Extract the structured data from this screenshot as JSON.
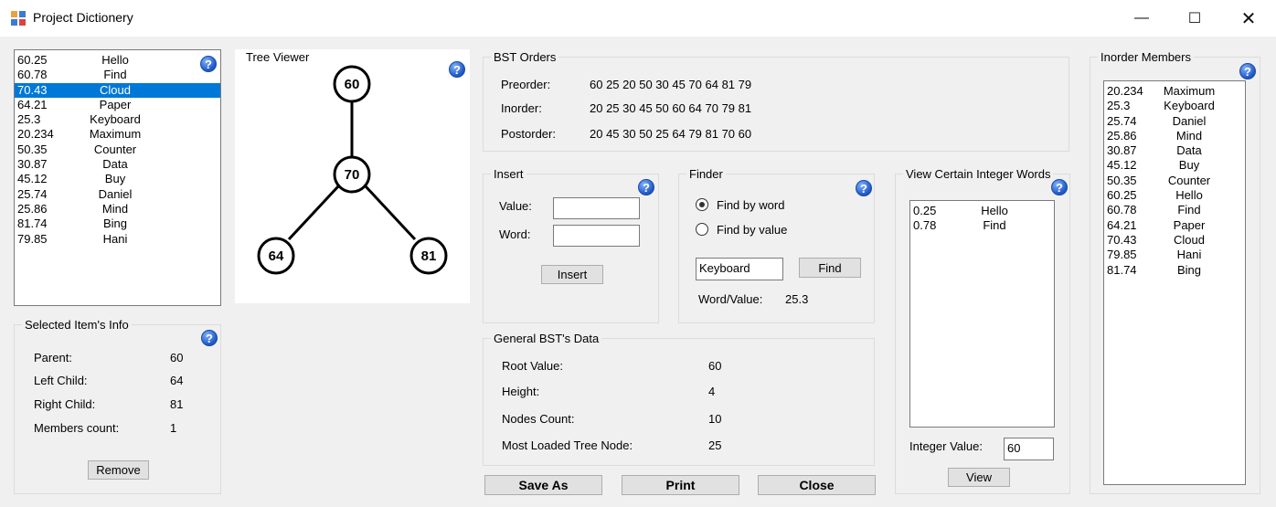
{
  "window": {
    "title": "Project Dictionery",
    "minimize_glyph": "—",
    "maximize_glyph": "☐",
    "close_glyph": "✕"
  },
  "help_glyph": "?",
  "main_list": {
    "items": [
      {
        "value": "60.25",
        "word": "Hello"
      },
      {
        "value": "60.78",
        "word": "Find"
      },
      {
        "value": "70.43",
        "word": "Cloud",
        "selected": true
      },
      {
        "value": "64.21",
        "word": "Paper"
      },
      {
        "value": "25.3",
        "word": "Keyboard"
      },
      {
        "value": "20.234",
        "word": "Maximum"
      },
      {
        "value": "50.35",
        "word": "Counter"
      },
      {
        "value": "30.87",
        "word": "Data"
      },
      {
        "value": "45.12",
        "word": "Buy"
      },
      {
        "value": "25.74",
        "word": "Daniel"
      },
      {
        "value": "25.86",
        "word": "Mind"
      },
      {
        "value": "81.74",
        "word": "Bing"
      },
      {
        "value": "79.85",
        "word": "Hani"
      }
    ]
  },
  "selected_info": {
    "title": "Selected Item's Info",
    "parent_label": "Parent:",
    "parent_value": "60",
    "left_label": "Left Child:",
    "left_value": "64",
    "right_label": "Right Child:",
    "right_value": "81",
    "count_label": "Members count:",
    "count_value": "1",
    "remove_button": "Remove"
  },
  "tree_viewer": {
    "title": "Tree Viewer",
    "nodes": {
      "root": "60",
      "mid": "70",
      "left": "64",
      "right": "81"
    }
  },
  "bst_orders": {
    "title": "BST Orders",
    "preorder_label": "Preorder:",
    "preorder_value": "60 25 20 50 30 45 70 64 81 79",
    "inorder_label": "Inorder:",
    "inorder_value": "20 25 30 45 50 60 64 70 79 81",
    "postorder_label": "Postorder:",
    "postorder_value": "20 45 30 50 25 64 79 81 70 60"
  },
  "insert": {
    "title": "Insert",
    "value_label": "Value:",
    "value_input": "",
    "word_label": "Word:",
    "word_input": "",
    "button": "Insert"
  },
  "finder": {
    "title": "Finder",
    "by_word_label": "Find by word",
    "by_value_label": "Find by value",
    "selected_mode": "word",
    "query": "Keyboard",
    "button": "Find",
    "result_label": "Word/Value:",
    "result_value": "25.3"
  },
  "general": {
    "title": "General BST's Data",
    "root_label": "Root Value:",
    "root_value": "60",
    "height_label": "Height:",
    "height_value": "4",
    "nodes_label": "Nodes Count:",
    "nodes_value": "10",
    "loaded_label": "Most Loaded Tree Node:",
    "loaded_value": "25"
  },
  "integer_words": {
    "title": "View Certain Integer Words",
    "items": [
      {
        "value": "0.25",
        "word": "Hello"
      },
      {
        "value": "0.78",
        "word": "Find"
      }
    ],
    "int_label": "Integer Value:",
    "int_value": "60",
    "button": "View"
  },
  "inorder_members": {
    "title": "Inorder Members",
    "items": [
      {
        "value": "20.234",
        "word": "Maximum"
      },
      {
        "value": "25.3",
        "word": "Keyboard"
      },
      {
        "value": "25.74",
        "word": "Daniel"
      },
      {
        "value": "25.86",
        "word": "Mind"
      },
      {
        "value": "30.87",
        "word": "Data"
      },
      {
        "value": "45.12",
        "word": "Buy"
      },
      {
        "value": "50.35",
        "word": "Counter"
      },
      {
        "value": "60.25",
        "word": "Hello"
      },
      {
        "value": "60.78",
        "word": "Find"
      },
      {
        "value": "64.21",
        "word": "Paper"
      },
      {
        "value": "70.43",
        "word": "Cloud"
      },
      {
        "value": "79.85",
        "word": "Hani"
      },
      {
        "value": "81.74",
        "word": "Bing"
      }
    ]
  },
  "bottom_buttons": {
    "save": "Save As",
    "print": "Print",
    "close": "Close"
  },
  "colors": {
    "selection": "#0078d7",
    "window_bg": "#f0f0f0",
    "help_icon": "#1d56c4"
  }
}
